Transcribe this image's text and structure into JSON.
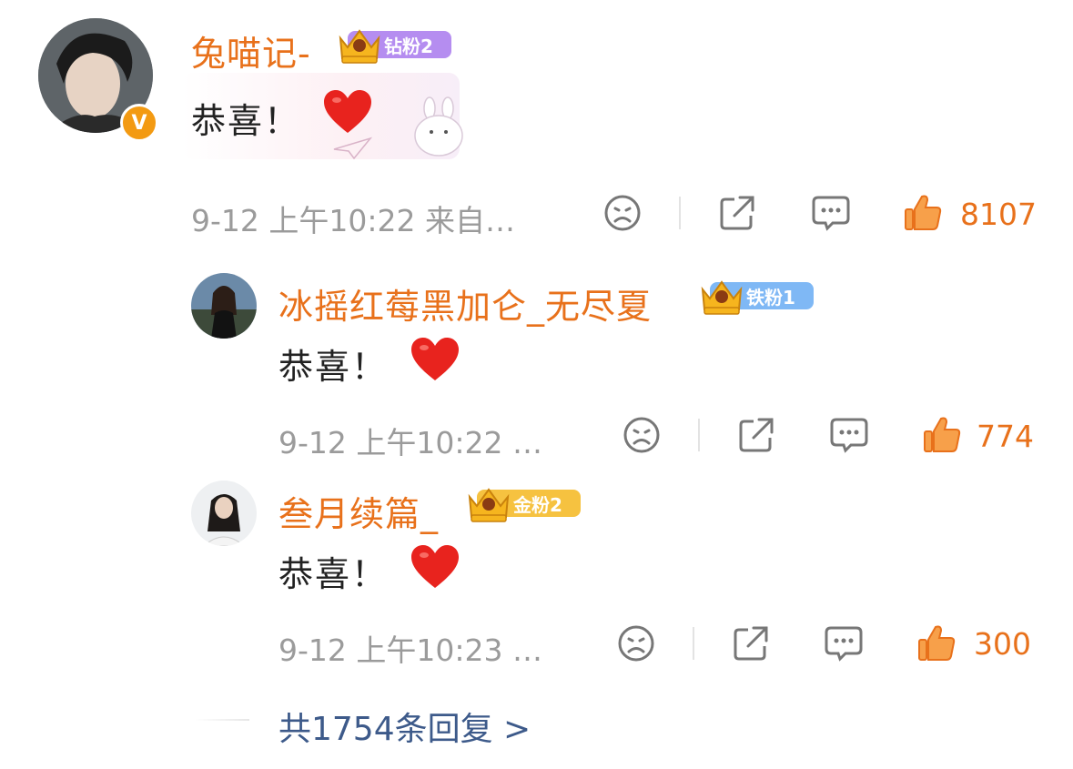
{
  "comment": {
    "username": "兔喵记-",
    "badge": "钻粉2",
    "text": "恭喜！",
    "meta": "9-12  上午10:22  来自…",
    "likes": "8107",
    "verified_icon": "v-verified-icon",
    "badge_color": "#b58df0"
  },
  "replies": [
    {
      "username": "冰摇红莓黑加仑_无尽夏",
      "badge": "铁粉1",
      "text": "恭喜！",
      "meta": "9-12  上午10:22  …",
      "likes": "774",
      "badge_color": "#7fb8f5"
    },
    {
      "username": "叁月续篇_",
      "badge": "金粉2",
      "text": "恭喜！",
      "meta": "9-12  上午10:23  …",
      "likes": "300",
      "badge_color": "#f6c240"
    }
  ],
  "more_replies": "共1754条回复 >",
  "colors": {
    "accent": "#e8711b",
    "link": "#3d5a8a",
    "meta": "#9b9b9b"
  }
}
